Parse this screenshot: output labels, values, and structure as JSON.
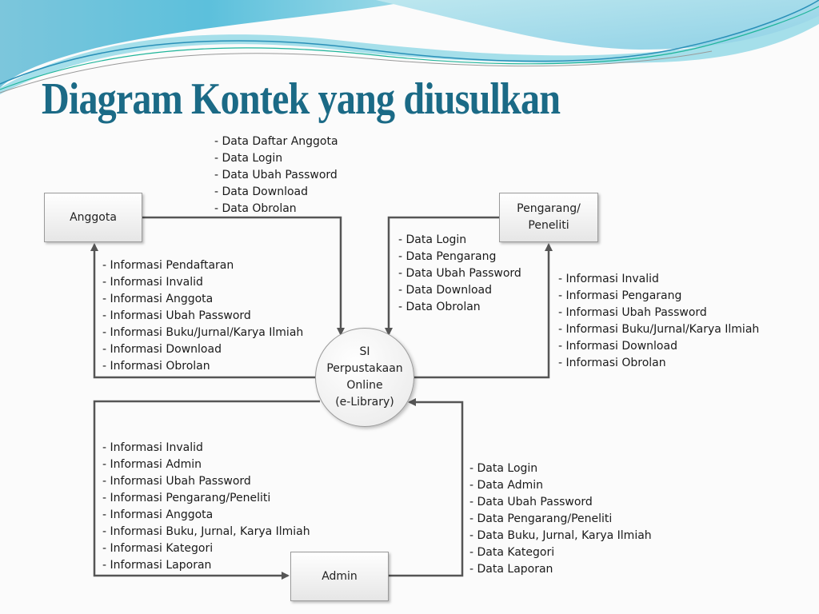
{
  "slide": {
    "title": "Diagram Kontek yang diusulkan",
    "colors": {
      "title": "#1b6a86",
      "wave_light": "#a9dde8",
      "wave_mid": "#6cc4dc",
      "line": "#555555"
    }
  },
  "entities": {
    "anggota": {
      "label": "Anggota"
    },
    "pengarang": {
      "label_line1": "Pengarang/",
      "label_line2": "Peneliti"
    },
    "admin": {
      "label": "Admin"
    }
  },
  "process": {
    "line1": "SI",
    "line2": "Perpustakaan",
    "line3": "Online",
    "line4": "(e-Library)"
  },
  "flows": {
    "anggota_to_system": [
      "Data Daftar Anggota",
      "Data Login",
      "Data Ubah Password",
      "Data Download",
      "Data Obrolan"
    ],
    "system_to_anggota": [
      "Informasi Pendaftaran",
      "Informasi Invalid",
      "Informasi Anggota",
      "Informasi Ubah Password",
      "Informasi Buku/Jurnal/Karya Ilmiah",
      "Informasi Download",
      "Informasi Obrolan"
    ],
    "pengarang_to_system": [
      "Data Login",
      "Data Pengarang",
      "Data Ubah Password",
      "Data Download",
      "Data Obrolan"
    ],
    "system_to_pengarang": [
      "Informasi Invalid",
      "Informasi Pengarang",
      "Informasi Ubah Password",
      "Informasi Buku/Jurnal/Karya Ilmiah",
      "Informasi Download",
      "Informasi Obrolan"
    ],
    "system_to_admin": [
      "Informasi Invalid",
      "Informasi Admin",
      "Informasi Ubah Password",
      "Informasi Pengarang/Peneliti",
      "Informasi Anggota",
      "Informasi Buku, Jurnal, Karya Ilmiah",
      "Informasi Kategori",
      "Informasi Laporan"
    ],
    "admin_to_system": [
      "Data Login",
      "Data Admin",
      "Data Ubah Password",
      "Data Pengarang/Peneliti",
      "Data Buku, Jurnal, Karya Ilmiah",
      "Data Kategori",
      "Data Laporan"
    ]
  }
}
